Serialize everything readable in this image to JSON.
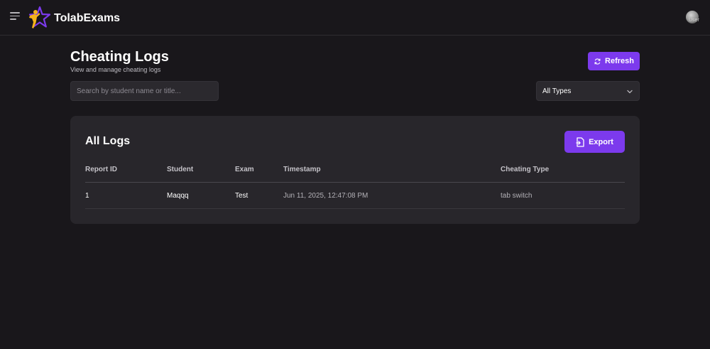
{
  "header": {
    "brand": "TolabExams",
    "avatar_alt": "User"
  },
  "page": {
    "title": "Cheating Logs",
    "subtitle": "View and manage cheating logs",
    "refresh_label": "Refresh"
  },
  "filters": {
    "search_placeholder": "Search by student name or title...",
    "search_value": "",
    "type_selected": "All Types"
  },
  "logs": {
    "title": "All Logs",
    "export_label": "Export",
    "columns": [
      "Report ID",
      "Student",
      "Exam",
      "Timestamp",
      "Cheating Type"
    ],
    "rows": [
      {
        "report_id": "1",
        "student": "Maqqq",
        "exam": "Test",
        "timestamp": "Jun 11, 2025, 12:47:08 PM",
        "cheating_type": "tab switch"
      }
    ]
  },
  "colors": {
    "accent": "#7c3aed",
    "background": "#19171b",
    "card": "#28262b"
  },
  "icons": {
    "menu": "menu-icon",
    "logo": "star-logo-icon",
    "refresh": "refresh-icon",
    "export": "export-file-icon",
    "dropdown": "chevron-down-icon"
  }
}
